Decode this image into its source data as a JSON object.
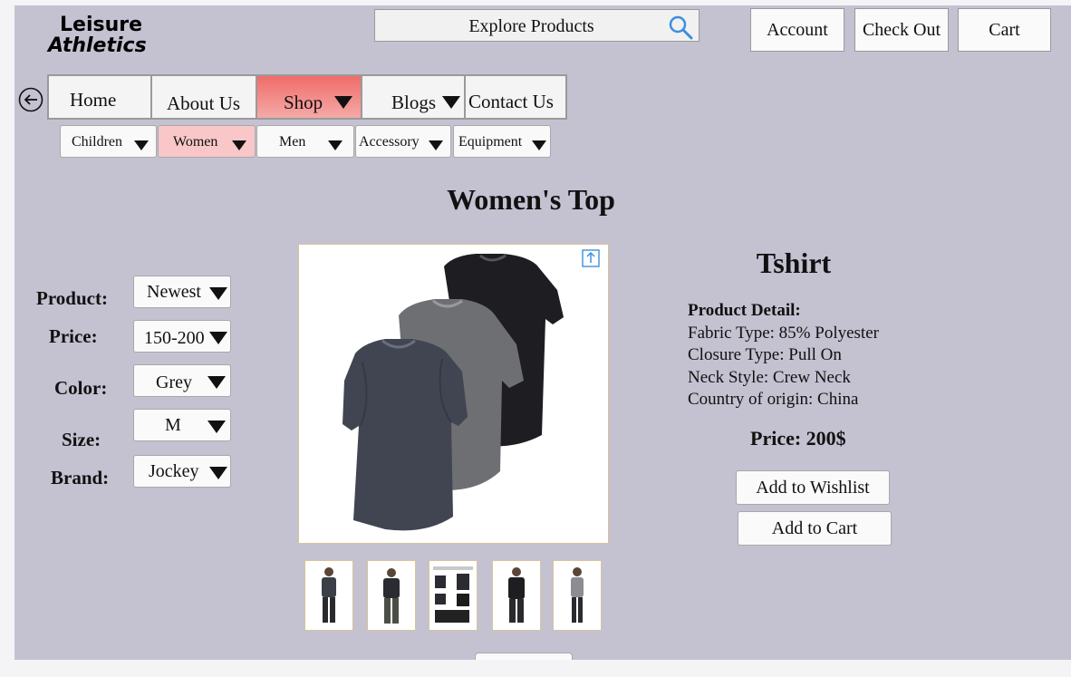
{
  "brand": {
    "line1": "Leisure",
    "line2": "Athletics"
  },
  "search": {
    "label": "Explore Products"
  },
  "top_buttons": {
    "account": "Account",
    "checkout": "Check Out",
    "cart": "Cart"
  },
  "nav": {
    "home": "Home",
    "about": "About Us",
    "shop": "Shop",
    "blogs": "Blogs",
    "contact": "Contact Us"
  },
  "subnav": {
    "children": "Children",
    "women": "Women",
    "men": "Men",
    "accessory": "Accessory",
    "equipment": "Equipment"
  },
  "page_title": "Women's Top",
  "filters": {
    "product": {
      "label": "Product:",
      "value": "Newest"
    },
    "price": {
      "label": "Price:",
      "value": "150-200"
    },
    "color": {
      "label": "Color:",
      "value": "Grey"
    },
    "size": {
      "label": "Size:",
      "value": "M"
    },
    "brand": {
      "label": "Brand:",
      "value": "Jockey"
    }
  },
  "product": {
    "name": "Tshirt",
    "detail_heading": "Product Detail:",
    "details": [
      "Fabric Type: 85% Polyester",
      "Closure Type: Pull On",
      "Neck Style: Crew Neck",
      "Country of origin: China"
    ],
    "price": "Price: 200$",
    "wishlist_label": "Add to Wishlist",
    "cart_label": "Add to Cart"
  },
  "colors": {
    "background": "#c4c1d1",
    "active_nav": "#ea7c78",
    "active_subnav": "#f9c7c8",
    "search_icon": "#3d8ee0"
  },
  "icons": {
    "back": "back-arrow-icon",
    "search": "search-icon",
    "share": "share-icon",
    "dropdown": "caret-down-icon"
  }
}
